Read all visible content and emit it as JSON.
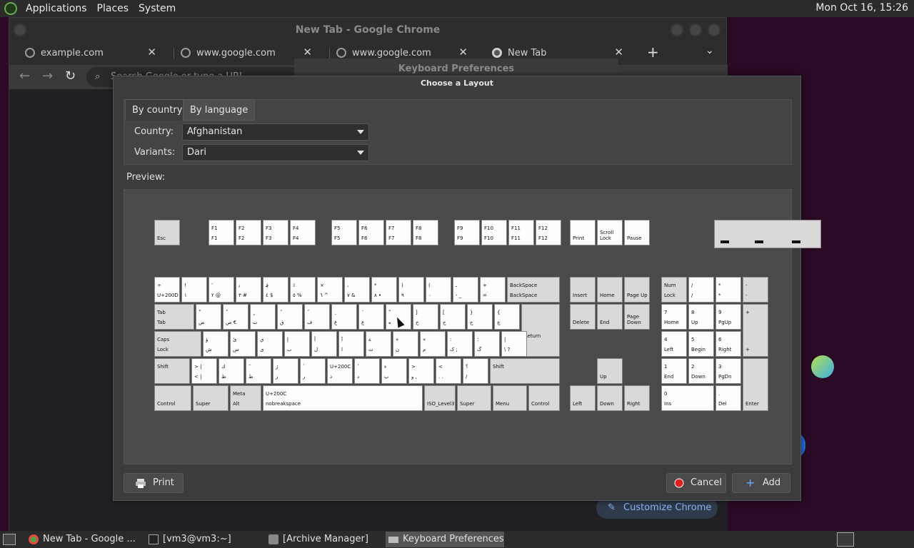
{
  "top_panel": {
    "menus": [
      "Applications",
      "Places",
      "System"
    ],
    "clock": "Mon Oct 16, 15:26"
  },
  "chrome": {
    "title": "New Tab - Google Chrome",
    "tabs": [
      {
        "label": "example.com",
        "icon": "globe-icon"
      },
      {
        "label": "www.google.com",
        "icon": "globe-icon"
      },
      {
        "label": "www.google.com",
        "icon": "globe-icon"
      },
      {
        "label": "New Tab",
        "icon": "chrome-icon"
      }
    ],
    "omnibox_placeholder": "Search Google or type a URL",
    "customize_label": "Customize Chrome"
  },
  "keyboard_prefs_title": "Keyboard Preferences",
  "dialog": {
    "title": "Choose a Layout",
    "tabs": [
      "By country",
      "By language"
    ],
    "country_label": "Country:",
    "country_value": "Afghanistan",
    "variants_label": "Variants:",
    "variants_value": "Dari",
    "preview_label": "Preview:",
    "print_label": "Print",
    "cancel_label": "Cancel",
    "add_label": "Add"
  },
  "taskbar": {
    "items": [
      {
        "label": "New Tab - Google ...",
        "icon": "chrome-icon"
      },
      {
        "label": "[vm3@vm3:~]",
        "icon": "terminal-icon"
      },
      {
        "label": "[Archive Manager]",
        "icon": "archive-icon"
      },
      {
        "label": "Keyboard Preferences",
        "icon": "keyboard-icon"
      }
    ]
  },
  "keyboard": {
    "rows": {
      "fn": [
        {
          "id": "esc",
          "l": "Esc"
        },
        {
          "id": "f1",
          "l": "F1"
        },
        {
          "id": "f2",
          "l": "F2"
        },
        {
          "id": "f3",
          "l": "F3"
        },
        {
          "id": "f4",
          "l": "F4"
        },
        {
          "id": "f5",
          "l": "F5"
        },
        {
          "id": "f6",
          "l": "F6"
        },
        {
          "id": "f7",
          "l": "F7"
        },
        {
          "id": "f8",
          "l": "F8"
        },
        {
          "id": "f9",
          "l": "F9"
        },
        {
          "id": "f10",
          "l": "F10"
        },
        {
          "id": "f11",
          "l": "F11"
        },
        {
          "id": "f12",
          "l": "F12"
        },
        {
          "id": "print",
          "l": "Print"
        },
        {
          "id": "scroll",
          "l": "Scroll Lock"
        },
        {
          "id": "pause",
          "l": "Pause"
        }
      ],
      "number": [
        {
          "t1": "÷",
          "t2": "U+200D"
        },
        {
          "t1": "!",
          "t2": "١"
        },
        {
          "t1": "٬",
          "t2": "٢ @"
        },
        {
          "t1": "٫",
          "t2": "٣ #"
        },
        {
          "t1": "؋",
          "t2": "٤ $"
        },
        {
          "t1": "٪",
          "t2": "٥ %"
        },
        {
          "t1": "×",
          "t2": "٦ ^"
        },
        {
          "t1": "،",
          "t2": "٧ &"
        },
        {
          "t1": "*",
          "t2": "٨ •"
        },
        {
          "t1": ")",
          "t2": "٩"
        },
        {
          "t1": "(",
          "t2": "٠"
        },
        {
          "t1": "ـ",
          "t2": "- _"
        },
        {
          "t1": "+",
          "t2": "="
        },
        {
          "t1": "BackSpace",
          "t2": "BackSpace"
        }
      ],
      "qwerty": [
        {
          "t1": "Tab",
          "t2": "Tab"
        },
        {
          "t1": "ْ",
          "t2": "ض"
        },
        {
          "t1": "ٌ",
          "t2": "ص €"
        },
        {
          "t1": "ٍ",
          "t2": "ث"
        },
        {
          "t1": "ً",
          "t2": "ق"
        },
        {
          "t1": "ُ",
          "t2": "ف"
        },
        {
          "t1": "ِ",
          "t2": "غ"
        },
        {
          "t1": "َ",
          "t2": "ع"
        },
        {
          "t1": "ّ",
          "t2": "ه"
        },
        {
          "t1": "]",
          "t2": "خ"
        },
        {
          "t1": "[",
          "t2": "ح"
        },
        {
          "t1": "}",
          "t2": "ج"
        },
        {
          "t1": "{",
          "t2": "چ"
        }
      ],
      "home": [
        {
          "t1": "Caps",
          "t2": "Lock"
        },
        {
          "t1": "ؤ",
          "t2": "ش"
        },
        {
          "t1": "ئ",
          "t2": "س"
        },
        {
          "t1": "ي",
          "t2": "ی"
        },
        {
          "t1": "إ",
          "t2": "ب"
        },
        {
          "t1": "أ",
          "t2": "ل"
        },
        {
          "t1": "آ",
          "t2": "ا"
        },
        {
          "t1": "ة",
          "t2": "ت"
        },
        {
          "t1": "»",
          "t2": "ن"
        },
        {
          "t1": "«",
          "t2": "م"
        },
        {
          "t1": ":",
          "t2": "ک ;"
        },
        {
          "t1": "؛",
          "t2": "گ"
        },
        {
          "t1": "|",
          "t2": "\\ ?"
        }
      ],
      "shift": [
        {
          "t1": "Shift",
          "t2": ""
        },
        {
          "t1": "> |",
          "t2": "< |"
        },
        {
          "t1": "ك",
          "t2": "ظ"
        },
        {
          "t1": "ٓ",
          "t2": "ط"
        },
        {
          "t1": "ژ",
          "t2": "ز"
        },
        {
          "t1": "ٰ",
          "t2": "ر"
        },
        {
          "t1": "U+200C",
          "t2": "ذ"
        },
        {
          "t1": "ٔ",
          "t2": "د"
        },
        {
          "t1": "ء",
          "t2": "پ"
        },
        {
          "t1": ">",
          "t2": "و ,"
        },
        {
          "t1": "<",
          "t2": ". ."
        },
        {
          "t1": "؟",
          "t2": "/"
        },
        {
          "t1": "Shift",
          "t2": ""
        }
      ],
      "bottom": [
        {
          "t1": "",
          "t2": "Control"
        },
        {
          "t1": "",
          "t2": "Super"
        },
        {
          "t1": "Meta",
          "t2": "Alt"
        },
        {
          "t1": "U+200C",
          "t2": "nobreakspace"
        },
        {
          "t1": "",
          "t2": "ISO_Level3..."
        },
        {
          "t1": "",
          "t2": "Super"
        },
        {
          "t1": "",
          "t2": "Menu"
        },
        {
          "t1": "",
          "t2": "Control"
        }
      ],
      "nav": [
        {
          "t": "Insert"
        },
        {
          "t": "Home"
        },
        {
          "t": "Page Up"
        },
        {
          "t": "Delete"
        },
        {
          "t": "End"
        },
        {
          "t": "Page Down"
        },
        {
          "t": "Up"
        },
        {
          "t": "Left"
        },
        {
          "t": "Down"
        },
        {
          "t": "Right"
        }
      ],
      "numpad": [
        {
          "t1": "Num",
          "t2": "Lock"
        },
        {
          "t1": "/",
          "t2": "/"
        },
        {
          "t1": "*",
          "t2": "*"
        },
        {
          "t1": "-",
          "t2": "-"
        },
        {
          "t1": "7",
          "t2": "Home"
        },
        {
          "t1": "8",
          "t2": "Up"
        },
        {
          "t1": "9",
          "t2": "PgUp"
        },
        {
          "t1": "+",
          "t2": "+"
        },
        {
          "t1": "4",
          "t2": "Left"
        },
        {
          "t1": "5",
          "t2": "Begin"
        },
        {
          "t1": "6",
          "t2": "Right"
        },
        {
          "t1": "1",
          "t2": "End"
        },
        {
          "t1": "2",
          "t2": "Down"
        },
        {
          "t1": "3",
          "t2": "PgDn"
        },
        {
          "t1": "",
          "t2": "Enter"
        },
        {
          "t1": "0",
          "t2": "Ins"
        },
        {
          "t1": ".",
          "t2": "Del"
        }
      ],
      "return_label": "Return"
    }
  }
}
